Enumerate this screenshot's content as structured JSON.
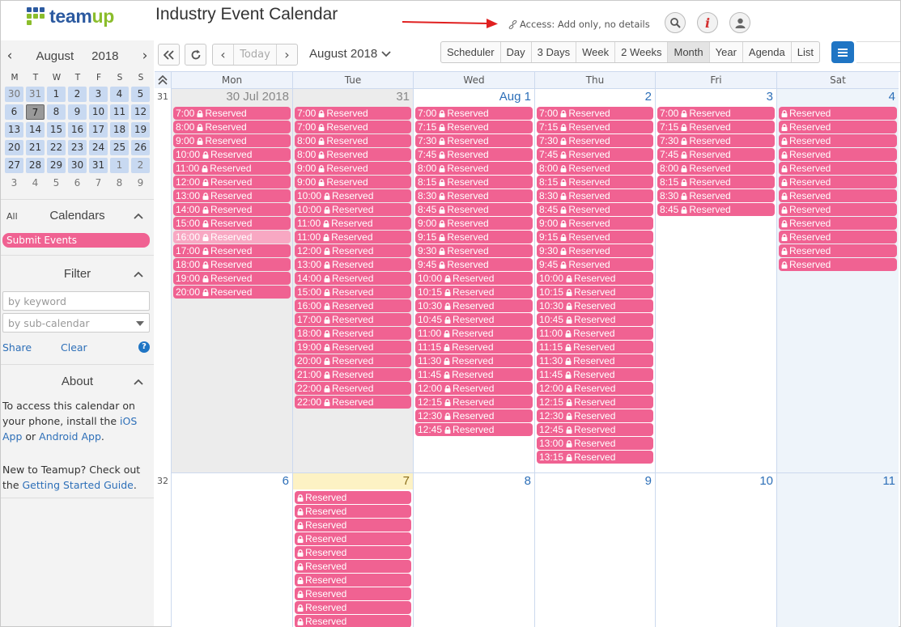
{
  "app": {
    "logo_left": "team",
    "logo_right": "up",
    "title": "Industry Event Calendar",
    "access_text": "Access: Add only, no details",
    "colors": {
      "brand_blue": "#2c5aa0",
      "brand_green": "#8bbd2c",
      "event_pink": "#f06292",
      "accent_blue": "#1f75c4",
      "arrow_red": "#e02020"
    }
  },
  "header_buttons": [
    {
      "name": "search-icon"
    },
    {
      "name": "info-icon",
      "glyph": "i"
    },
    {
      "name": "user-icon"
    }
  ],
  "sidebar": {
    "mini_month": "August",
    "mini_year": "2018",
    "weekdays": [
      "M",
      "T",
      "W",
      "T",
      "F",
      "S",
      "S"
    ],
    "weeks": [
      [
        "30",
        "31",
        "1",
        "2",
        "3",
        "4",
        "5"
      ],
      [
        "6",
        "7",
        "8",
        "9",
        "10",
        "11",
        "12"
      ],
      [
        "13",
        "14",
        "15",
        "16",
        "17",
        "18",
        "19"
      ],
      [
        "20",
        "21",
        "22",
        "23",
        "24",
        "25",
        "26"
      ],
      [
        "27",
        "28",
        "29",
        "30",
        "31",
        "1",
        "2"
      ],
      [
        "3",
        "4",
        "5",
        "6",
        "7",
        "8",
        "9"
      ]
    ],
    "selected_day": "7",
    "calendars_all": "All",
    "calendars_title": "Calendars",
    "calendar_item": "Submit Events",
    "filter_title": "Filter",
    "keyword_placeholder": "by keyword",
    "subcal_placeholder": "by sub-calendar",
    "share": "Share",
    "clear": "Clear",
    "help": "?",
    "about_title": "About",
    "about_1a": "To access this calendar on your phone, install the ",
    "about_1_ios": "iOS App",
    "about_1_or": " or ",
    "about_1_android": "Android App",
    "about_1_end": ".",
    "about_2a": "New to Teamup? Check out the ",
    "about_2_link": "Getting Started Guide",
    "about_2_end": "."
  },
  "toolbar": {
    "today": "Today",
    "current": "August 2018",
    "views": [
      "Scheduler",
      "Day",
      "3 Days",
      "Week",
      "2 Weeks",
      "Month",
      "Year",
      "Agenda",
      "List"
    ],
    "active_view": "Month"
  },
  "calendar": {
    "weekdays": [
      "Mon",
      "Tue",
      "Wed",
      "Thu",
      "Fri",
      "Sat"
    ],
    "weeks": [
      {
        "week_no": "31",
        "days": [
          {
            "label": "30 Jul 2018",
            "grey": true,
            "events": [
              "7:00",
              "8:00",
              "9:00",
              "10:00",
              "11:00",
              "12:00",
              "13:00",
              "14:00",
              "15:00",
              "16:00",
              "17:00",
              "18:00",
              "19:00",
              "20:00"
            ],
            "past_index": 9
          },
          {
            "label": "31",
            "grey": true,
            "events": [
              "7:00",
              "7:00",
              "8:00",
              "8:00",
              "9:00",
              "9:00",
              "10:00",
              "10:00",
              "11:00",
              "11:00",
              "12:00",
              "13:00",
              "14:00",
              "15:00",
              "16:00",
              "17:00",
              "18:00",
              "19:00",
              "20:00",
              "21:00",
              "22:00",
              "22:00"
            ]
          },
          {
            "label": "Aug 1",
            "events": [
              "7:00",
              "7:15",
              "7:30",
              "7:45",
              "8:00",
              "8:15",
              "8:30",
              "8:45",
              "9:00",
              "9:15",
              "9:30",
              "9:45",
              "10:00",
              "10:15",
              "10:30",
              "10:45",
              "11:00",
              "11:15",
              "11:30",
              "11:45",
              "12:00",
              "12:15",
              "12:30",
              "12:45"
            ]
          },
          {
            "label": "2",
            "events": [
              "7:00",
              "7:15",
              "7:30",
              "7:45",
              "8:00",
              "8:15",
              "8:30",
              "8:45",
              "9:00",
              "9:15",
              "9:30",
              "9:45",
              "10:00",
              "10:15",
              "10:30",
              "10:45",
              "11:00",
              "11:15",
              "11:30",
              "11:45",
              "12:00",
              "12:15",
              "12:30",
              "12:45",
              "13:00",
              "13:15"
            ]
          },
          {
            "label": "3",
            "events": [
              "7:00",
              "7:15",
              "7:30",
              "7:45",
              "8:00",
              "8:15",
              "8:30",
              "8:45"
            ]
          },
          {
            "label": "4",
            "events": [
              "",
              "",
              "",
              "",
              "",
              "",
              "",
              "",
              "",
              "",
              "",
              ""
            ]
          }
        ]
      },
      {
        "week_no": "32",
        "days": [
          {
            "label": "6",
            "events": []
          },
          {
            "label": "7",
            "today": true,
            "events": [
              "",
              "",
              "",
              "",
              "",
              "",
              "",
              "",
              "",
              ""
            ]
          },
          {
            "label": "8",
            "events": []
          },
          {
            "label": "9",
            "events": []
          },
          {
            "label": "10",
            "events": []
          },
          {
            "label": "11",
            "events": []
          }
        ]
      }
    ],
    "event_title": "Reserved"
  }
}
